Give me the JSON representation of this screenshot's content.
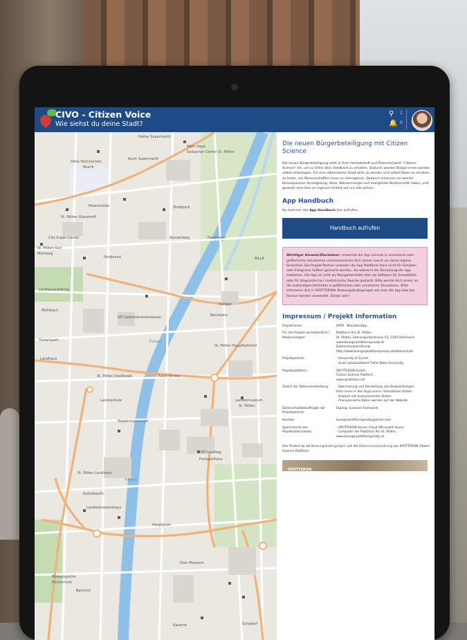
{
  "app": {
    "title": "CIVO - Citizen Voice",
    "subtitle": "Wie siehst du deine Stadt?",
    "notification_count_1": "1",
    "notification_count_2": "0"
  },
  "panel": {
    "heading": "Die neuen Bürgerbeteiligung mit Citizen Science",
    "intro": "Die neuen Bürgerbeteiligung setzt in Ihrer Heimatstadt und Österreichweit \"Citizens Science\" ein, um zu Orten Dein Feedback zu erhalten. Dadurch werden Bürger:innen werden selbst einbezogen. Für eine lebenswerte Stadt aktiv zu werden und selbst Daten zu erheben, zu teilen, mit Wissenschaftler:innen zu interagieren. Dadurch erkennen sie welche Konsequenzen Versiegelung, Hitze, Wassermangel und mangelnde Biodiversität haben, und generell eine Orte im eigenen Umfeld auf uns alle wirken.",
    "handbook_heading": "App Handbuch",
    "handbook_text_pre": "Du hast hier das ",
    "handbook_text_bold": "App Handbuch",
    "handbook_text_post": " hier aufrufen:",
    "handbook_button": "Handbuch aufrufen",
    "warning_bold": "Wichtiger Hinweis/Disclaimer:",
    "warning_text": " verwende die App niemals in unsicheren oder gefährlichen Situationen und konzentriere dich immer zuerst um deine eigene Sicherheit. Die Projekt-Partner und/oder die App Plattform kann nicht für Schäden oder Ereignisse haftbar gemacht werden, die während der Benutzung der App entstehen. Die App ist nicht als Navigationshilfe oder als Software für Einsatzfälle, oder für diagnostische / medizinische Zwecke gedacht. Bitte wende dich immer an die zuständigen Behörden in gefährlichen oder unsicheren Situationen. Bitte informiere dich in SPOTTERONs Nutzungsbedingungen wie man die App bzw das Service korrekt verwendet. Danke sehr!",
    "impressum_heading": "Impressum / Projekt Information",
    "impressum": [
      {
        "k": "Projektname:",
        "v": "URTA - MountainApp"
      },
      {
        "k": "Für das Projekt verantwortlich / Medieninhaber:",
        "v": "Plattform Pro St. Pölten\nSt. Pölten, Zehnergürtelstrasse 53, 3100 Österreich\nwww.buergerplattformprostp.at\nDatenschutzerklärung:\nhttp://www.buergerplattformprostp.at/datenschutz"
      },
      {
        "k": "Projektpartner:",
        "v": "- University of Zurich\n- Austri Janakiwitzkeit Tiefst Stata University"
      },
      {
        "k": "Projektplattform:",
        "v": "SPOTTERON GmbH\nCitizen Science Platform\nwww.spotteron.net"
      },
      {
        "k": "Zweck der Datenverarbeitung:",
        "v": "- Speicherung und Darstellung von Beobachtungen\nUser:innen in den Apps und in interaktiven Karten\n- Analyse mit anonymisierten Daten\n- Anonymisierte Daten werden auf der Website"
      },
      {
        "k": "Datenschutzbeauftragte der Projektpartner:",
        "v": "Dipling. Susanne Formanek"
      },
      {
        "k": "Kontakt:",
        "v": "buergerplattformprostp@gmail.com"
      },
      {
        "k": "Speicherorte des Projektdatensatzes:",
        "v": "- SPOTTERON Server Cloud (Microsoft Azure)\n- Computer der Plattform Pro St. Pölten, www.buergerplattformprostp.at"
      }
    ],
    "footer_pre": "Hier findest du die ",
    "footer_link1": "Nutzungsbedingungen",
    "footer_mid": " und die ",
    "footer_link2": "Datenschutzerklärung",
    "footer_post": " der SPOTTERON Citizen Science Plattform.",
    "strip_label": "SPOTTERON"
  },
  "map": {
    "labels": [
      "Hailey Supermarkt",
      "Alpin Aqua",
      "Seibacher Center",
      "St. Pölten",
      "Hella Technischen",
      "Bezirk",
      "Aurin Supermarkt",
      "St. Pölten Glanzstoff",
      "Maierstraße",
      "City Super Center",
      "St. Pölten Karl",
      "Mühlweg",
      "Ferdinand",
      "Stadtpark",
      "Feuerwehr",
      "Ranzenweg",
      "BILLA",
      "Lernhaussiedlung",
      "Dalliger",
      "Rennbahn",
      "Mühlbach",
      "NÖ Gebietskrankenkasse",
      "St. Pölten Hauptbahnhof",
      "Traisen",
      "Traisenpark",
      "Landhaus",
      "St. Pölten Stadtwald",
      "Punkt Kirche",
      "Landesmuseum",
      "St. Pölten",
      "Landsschule",
      "Regierungsviertel",
      "NÖ Landtag",
      "Festspielhaus",
      "St. Pölten Landhaus",
      "Kulturbezirk",
      "Landeskrankenhaus",
      "Pädagogische",
      "Hochschule",
      "Dom Museum",
      "Traisen",
      "Schadorf",
      "Hauptplatz",
      "Bahnhof",
      "Kaserne"
    ]
  }
}
